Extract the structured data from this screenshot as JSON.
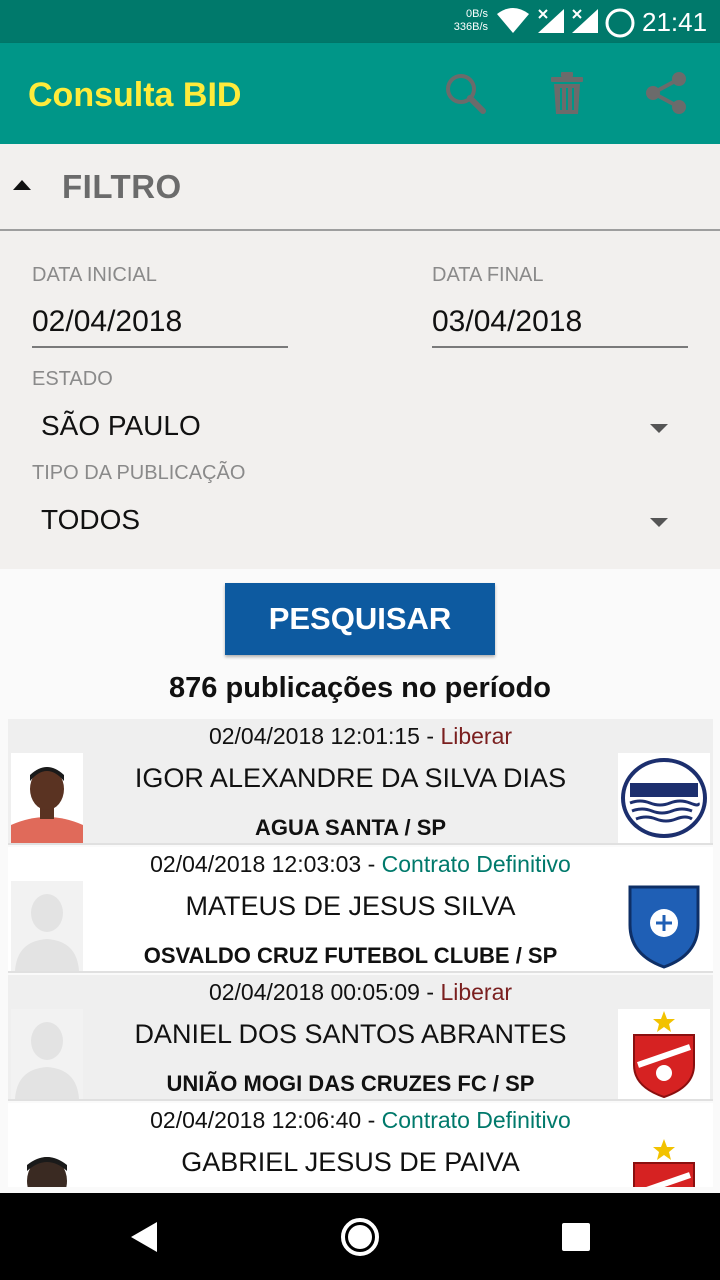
{
  "status_bar": {
    "net_down": "0B/s",
    "net_up": "336B/s",
    "time": "21:41",
    "icons": [
      "wifi-icon",
      "signal-x-icon",
      "signal-x-icon",
      "circle-icon"
    ]
  },
  "app_bar": {
    "title": "Consulta BID",
    "actions": [
      "search-icon",
      "trash-icon",
      "share-icon"
    ],
    "colors": {
      "background": "#009688",
      "title": "#ffeb3b"
    }
  },
  "filter": {
    "title": "FILTRO",
    "start_date_label": "DATA INICIAL",
    "start_date": "02/04/2018",
    "end_date_label": "DATA FINAL",
    "end_date": "03/04/2018",
    "state_label": "ESTADO",
    "state_value": "SÃO PAULO",
    "pub_type_label": "TIPO DA PUBLICAÇÃO",
    "pub_type_value": "TODOS"
  },
  "search_button": "PESQUISAR",
  "count_text": "876 publicações no período",
  "results": [
    {
      "datetime": "02/04/2018 12:01:15",
      "separator": " - ",
      "type": "Liberar",
      "name": "IGOR ALEXANDRE DA SILVA DIAS",
      "club": "AGUA SANTA / SP",
      "photo": "player-photo",
      "crest": "agua-santa-crest"
    },
    {
      "datetime": "02/04/2018 12:03:03",
      "separator": " - ",
      "type": "Contrato Definitivo",
      "name": "MATEUS DE JESUS SILVA",
      "club": "OSVALDO CRUZ FUTEBOL CLUBE / SP",
      "photo": "placeholder-avatar",
      "crest": "osvaldo-cruz-crest"
    },
    {
      "datetime": "02/04/2018 00:05:09",
      "separator": " - ",
      "type": "Liberar",
      "name": "DANIEL DOS SANTOS ABRANTES",
      "club": "UNIÃO MOGI DAS CRUZES FC / SP",
      "photo": "placeholder-avatar",
      "crest": "uniao-mogi-crest"
    },
    {
      "datetime": "02/04/2018 12:06:40",
      "separator": " - ",
      "type": "Contrato Definitivo",
      "name": "GABRIEL JESUS DE PAIVA",
      "club": "",
      "photo": "player-photo",
      "crest": "uniao-mogi-crest"
    }
  ],
  "nav_bar": [
    "back-icon",
    "home-icon",
    "recents-icon"
  ]
}
